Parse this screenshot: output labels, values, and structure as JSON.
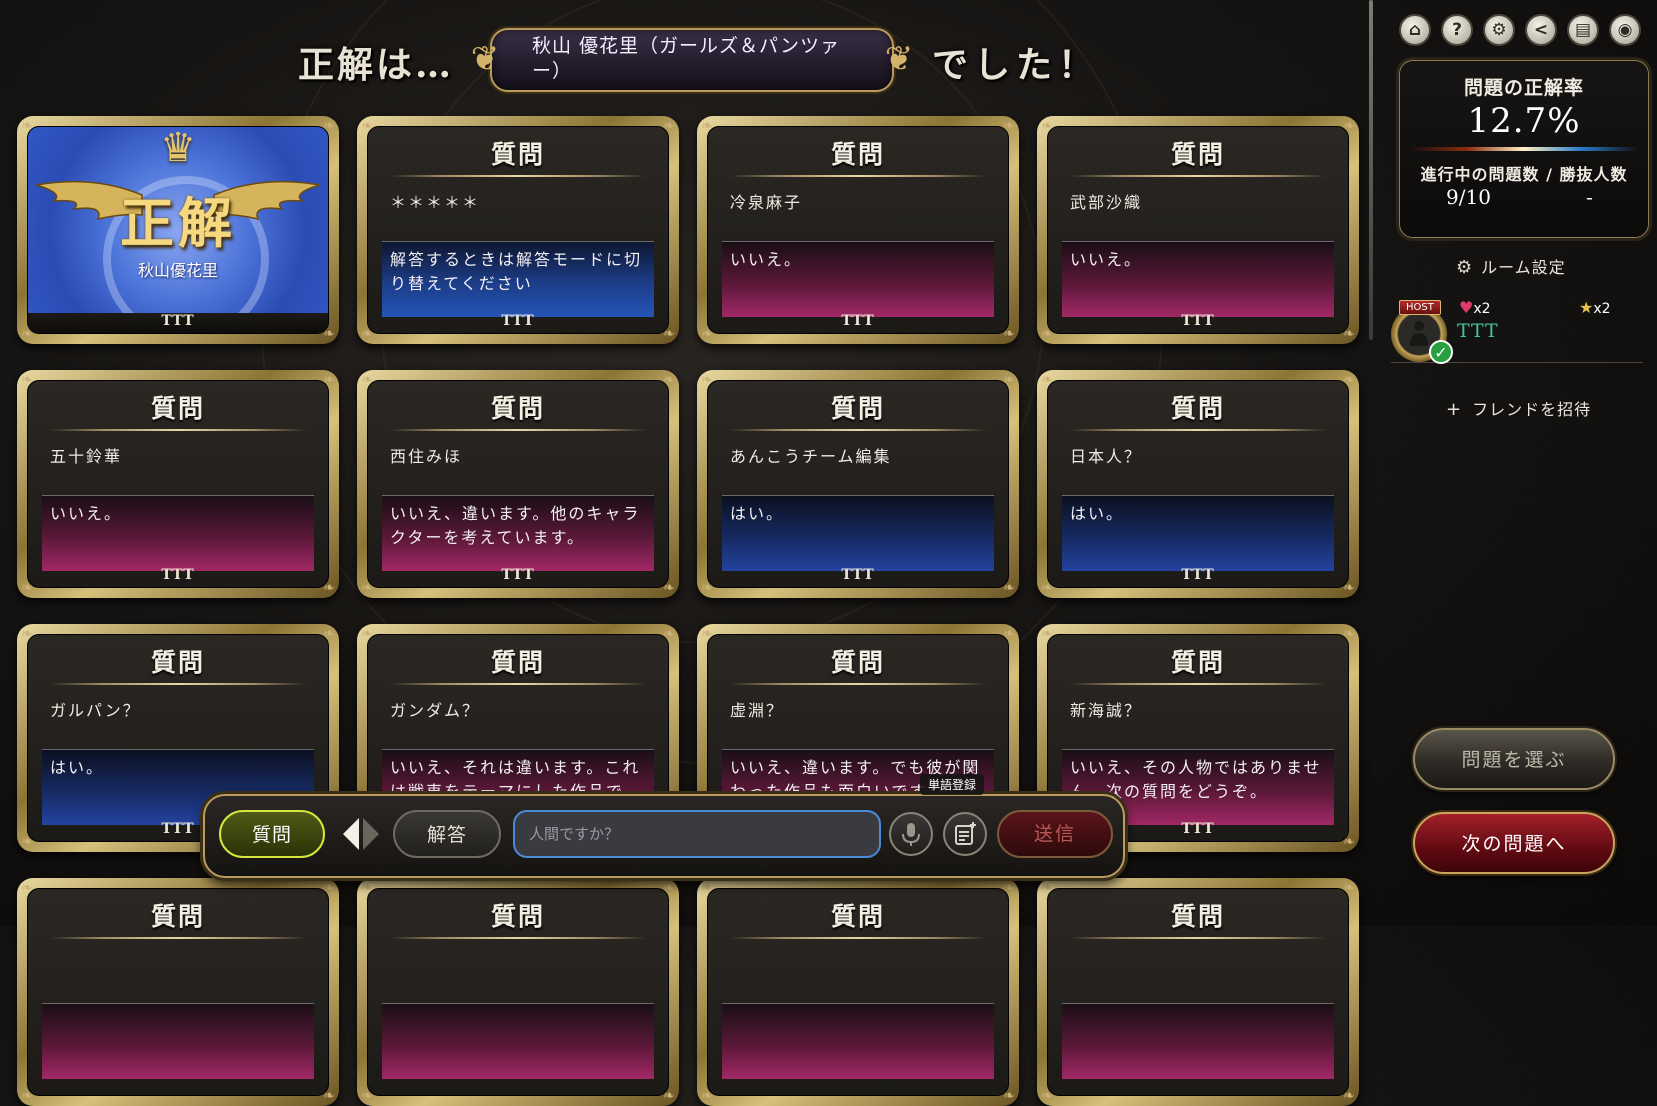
{
  "banner": {
    "lead": "正解は…",
    "answer": "秋山 優花里（ガールズ＆パンツァー）",
    "tail": "でした！"
  },
  "cards": [
    {
      "type": "win",
      "mark": "正解",
      "answer": "秋山優花里",
      "player": "TTT"
    },
    {
      "type": "question",
      "title": "質問",
      "question": "＊＊＊＊＊",
      "reply": "解答するときは解答モードに切り替えてください",
      "reply_kind": "info",
      "player": "TTT"
    },
    {
      "type": "question",
      "title": "質問",
      "question": "冷泉麻子",
      "reply": "いいえ。",
      "reply_kind": "no",
      "player": "TTT"
    },
    {
      "type": "question",
      "title": "質問",
      "question": "武部沙織",
      "reply": "いいえ。",
      "reply_kind": "no",
      "player": "TTT"
    },
    {
      "type": "question",
      "title": "質問",
      "question": "五十鈴華",
      "reply": "いいえ。",
      "reply_kind": "no",
      "player": "TTT"
    },
    {
      "type": "question",
      "title": "質問",
      "question": "西住みほ",
      "reply": "いいえ、違います。他のキャラクターを考えています。",
      "reply_kind": "no",
      "player": "TTT"
    },
    {
      "type": "question",
      "title": "質問",
      "question": "あんこうチーム編集",
      "reply": "はい。",
      "reply_kind": "yes",
      "player": "TTT"
    },
    {
      "type": "question",
      "title": "質問",
      "question": "日本人？",
      "reply": "はい。",
      "reply_kind": "yes",
      "player": "TTT"
    },
    {
      "type": "question",
      "title": "質問",
      "question": "ガルパン？",
      "reply": "はい。",
      "reply_kind": "yes",
      "player": "TTT"
    },
    {
      "type": "question",
      "title": "質問",
      "question": "ガンダム？",
      "reply": "いいえ、それは違います。これは戦車をテーマにした作品です。",
      "reply_kind": "no",
      "player": "TTT"
    },
    {
      "type": "question",
      "title": "質問",
      "question": "虚淵？",
      "reply": "いいえ、違います。でも彼が関わった作品も面白いですね。",
      "reply_kind": "no",
      "player": "TTT"
    },
    {
      "type": "question",
      "title": "質問",
      "question": "新海誠？",
      "reply": "いいえ、その人物ではありません。次の質問をどうぞ。",
      "reply_kind": "no",
      "player": "TTT"
    },
    {
      "type": "question",
      "title": "質問",
      "question": "",
      "reply": "",
      "reply_kind": "no",
      "player": ""
    },
    {
      "type": "question",
      "title": "質問",
      "question": "",
      "reply": "",
      "reply_kind": "no",
      "player": ""
    },
    {
      "type": "question",
      "title": "質問",
      "question": "",
      "reply": "",
      "reply_kind": "no",
      "player": ""
    },
    {
      "type": "question",
      "title": "質問",
      "question": "",
      "reply": "",
      "reply_kind": "no",
      "player": ""
    }
  ],
  "top_icons": [
    {
      "name": "home-icon",
      "glyph": "⌂"
    },
    {
      "name": "help-icon",
      "glyph": "?"
    },
    {
      "name": "settings-icon",
      "glyph": "⚙"
    },
    {
      "name": "share-icon",
      "glyph": "<"
    },
    {
      "name": "card-icon",
      "glyph": "▤"
    },
    {
      "name": "discord-icon",
      "glyph": "◉"
    }
  ],
  "stats": {
    "title": "問題の正解率",
    "rate": "12.7%",
    "labels": "進行中の問題数 / 勝抜人数",
    "progress": "9/10",
    "winners": "-"
  },
  "room_settings": "ルーム設定",
  "player": {
    "host_badge": "HOST",
    "name": "TTT",
    "hearts": "x2",
    "stars": "x2"
  },
  "invite": "フレンドを招待",
  "buttons": {
    "choose": "問題を選ぶ",
    "next": "次の問題へ"
  },
  "input_bar": {
    "question_mode": "質問",
    "answer_mode": "解答",
    "placeholder": "人間ですか？",
    "send": "送信",
    "tooltip": "単語登録"
  },
  "colors": {
    "gold": "#c9a560",
    "no_reply": "#a22866",
    "yes_reply": "#2343a0",
    "player_name": "#3fc49a"
  }
}
